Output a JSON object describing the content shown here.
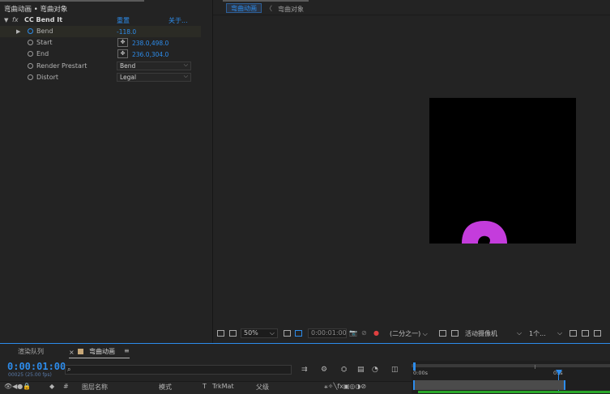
{
  "effect_controls": {
    "title": "弯曲动画 • 弯曲对象",
    "effect": {
      "fx_label": "fx",
      "name": "CC Bend It",
      "reset_label": "重置",
      "about_label": "关于..."
    },
    "params": [
      {
        "label": "Bend",
        "value": "-118.0"
      },
      {
        "label": "Start",
        "value": "238.0,498.0"
      },
      {
        "label": "End",
        "value": "236.0,304.0"
      },
      {
        "label": "Render Prestart",
        "value": "Bend"
      },
      {
        "label": "Distort",
        "value": "Legal"
      }
    ]
  },
  "viewer": {
    "tabs": [
      "弯曲动画",
      "弯曲对象"
    ],
    "breadcrumb_sep": "〈",
    "shape_color": "#c43cdc",
    "toolbar": {
      "zoom": "50%",
      "timecode": "0:00:01:00",
      "resolution": "(二分之一)",
      "camera": "活动摄像机",
      "views": "1个..."
    }
  },
  "timeline": {
    "tab_render_queue": "渲染队列",
    "tab_comp": "弯曲动画",
    "menu_icon": "≡",
    "close_icon": "×",
    "current_time": "0:00:01:00",
    "frame_info": "00025 (25.00 fps)",
    "search_placeholder": "",
    "headers": {
      "hash": "#",
      "layer_name": "图层名称",
      "mode": "模式",
      "t": "T",
      "trkmat": "TrkMat",
      "parent": "父级"
    },
    "ruler": {
      "start_label": "0:00s",
      "playhead_label": "01s"
    }
  },
  "colors": {
    "accent": "#2d8ceb",
    "panel_bg": "#232323",
    "canvas_bg": "#000000"
  }
}
